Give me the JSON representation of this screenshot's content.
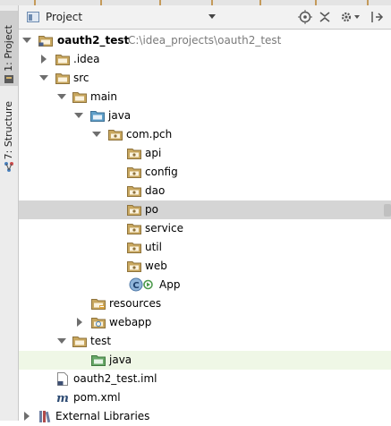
{
  "toolwindow_strip": {
    "project_tab_label": "1: Project",
    "structure_tab_label": "7: Structure"
  },
  "header": {
    "view_selector_label": "Project",
    "icons": [
      "project-view-icon",
      "dropdown-caret-icon",
      "scroll-from-source-icon",
      "collapse-all-icon",
      "settings-gear-icon",
      "hide-panel-icon"
    ]
  },
  "tree": {
    "root": {
      "name": "oauth2_test",
      "path": "C:\\idea_projects\\oauth2_test"
    },
    "idea": ".idea",
    "src": "src",
    "main": "main",
    "java": "java",
    "package": "com.pch",
    "pkg_api": "api",
    "pkg_config": "config",
    "pkg_dao": "dao",
    "pkg_po": "po",
    "pkg_service": "service",
    "pkg_util": "util",
    "pkg_web": "web",
    "app_class": "App",
    "resources": "resources",
    "webapp": "webapp",
    "test": "test",
    "test_java": "java",
    "iml_file": "oauth2_test.iml",
    "pom_file": "pom.xml",
    "external_libraries": "External Libraries"
  },
  "colors": {
    "folder": "#c8a75f",
    "source_folder": "#5f9fc9",
    "test_folder": "#68a868",
    "selection": "#d5d5d5",
    "test_row": "#eff7e6",
    "path_text": "#7a7a7a"
  }
}
